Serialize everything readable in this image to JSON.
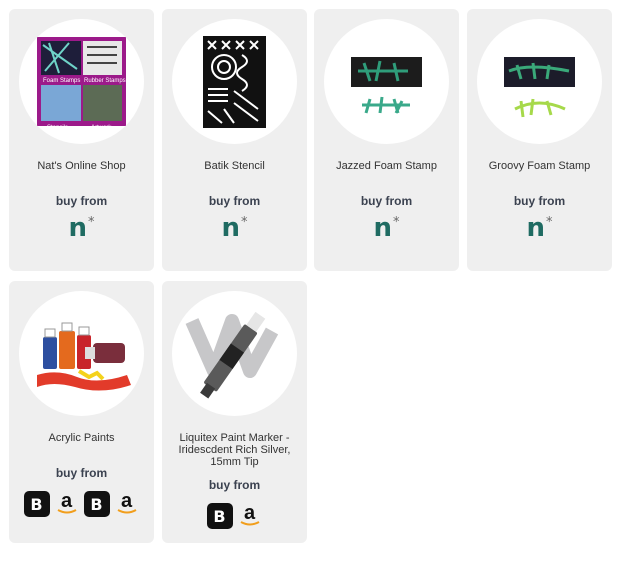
{
  "products": [
    {
      "name": "Nat's Online Shop",
      "buy_label": "buy from",
      "shops": [
        "n-icon"
      ]
    },
    {
      "name": "Batik Stencil",
      "buy_label": "buy from",
      "shops": [
        "n-icon"
      ]
    },
    {
      "name": "Jazzed Foam Stamp",
      "buy_label": "buy from",
      "shops": [
        "n-icon"
      ]
    },
    {
      "name": "Groovy Foam Stamp",
      "buy_label": "buy from",
      "shops": [
        "n-icon"
      ]
    },
    {
      "name": "Acrylic Paints",
      "buy_label": "buy from",
      "shops": [
        "b-icon",
        "amazon-icon",
        "b-icon",
        "amazon-icon"
      ]
    },
    {
      "name": "Liquitex Paint Marker - Iridescdent Rich Silver, 15mm Tip",
      "buy_label": "buy from",
      "shops": [
        "b-icon",
        "amazon-icon"
      ]
    }
  ],
  "collage": {
    "foam": "Foam Stamps",
    "rubber": "Rubber Stamps",
    "stencils": "Stencils",
    "artwork": "Artwork"
  },
  "logos": {
    "n": "n",
    "n_star": "*",
    "b": "B",
    "a": "a"
  },
  "colors": {
    "card": "#efefef",
    "button_text": "#3b4250",
    "n_logo": "#1f6b62",
    "collage": "#9c1a8a"
  }
}
